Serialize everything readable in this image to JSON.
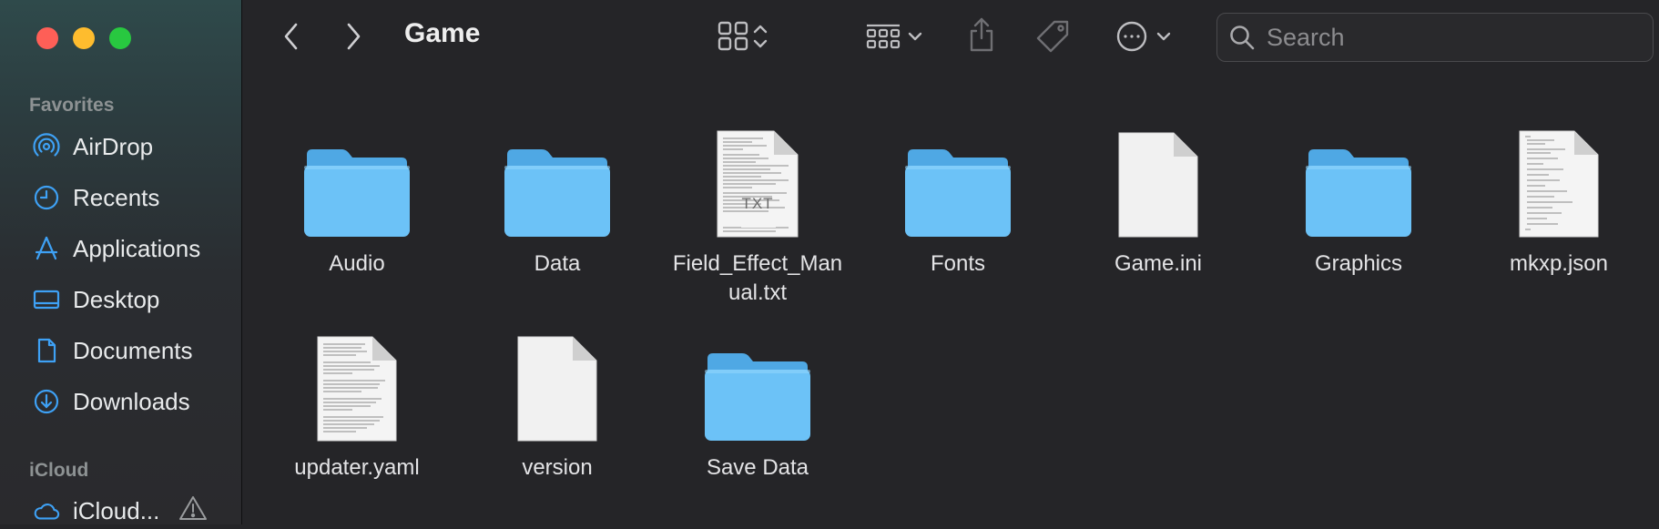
{
  "window": {
    "title": "Game"
  },
  "sidebar": {
    "favorites_heading": "Favorites",
    "icloud_heading": "iCloud",
    "favorites": [
      {
        "label": "AirDrop",
        "icon": "airdrop-icon"
      },
      {
        "label": "Recents",
        "icon": "clock-icon"
      },
      {
        "label": "Applications",
        "icon": "applications-icon"
      },
      {
        "label": "Desktop",
        "icon": "desktop-icon"
      },
      {
        "label": "Documents",
        "icon": "document-icon"
      },
      {
        "label": "Downloads",
        "icon": "download-icon"
      }
    ],
    "icloud": [
      {
        "label": "iCloud...",
        "icon": "cloud-icon",
        "status_icon": "warning-icon"
      }
    ]
  },
  "toolbar": {
    "back_icon": "chevron-left-icon",
    "forward_icon": "chevron-right-icon",
    "view_icon": "grid-view-icon",
    "group_icon": "group-by-icon",
    "share_icon": "share-icon",
    "tag_icon": "tag-icon",
    "action_icon": "more-actions-icon",
    "search_placeholder": "Search"
  },
  "files": [
    {
      "name": "Audio",
      "kind": "folder"
    },
    {
      "name": "Data",
      "kind": "folder"
    },
    {
      "name": "Field_Effect_Manual.txt",
      "kind": "txt"
    },
    {
      "name": "Fonts",
      "kind": "folder"
    },
    {
      "name": "Game.ini",
      "kind": "blank"
    },
    {
      "name": "Graphics",
      "kind": "folder"
    },
    {
      "name": "mkxp.json",
      "kind": "text"
    },
    {
      "name": "updater.yaml",
      "kind": "text"
    },
    {
      "name": "version",
      "kind": "blank"
    },
    {
      "name": "Save Data",
      "kind": "folder"
    }
  ],
  "txt_badge": "TXT",
  "colors": {
    "folder": "#6cc2f7",
    "folder_tab": "#4fa8e4",
    "accent": "#3ea1f5"
  }
}
